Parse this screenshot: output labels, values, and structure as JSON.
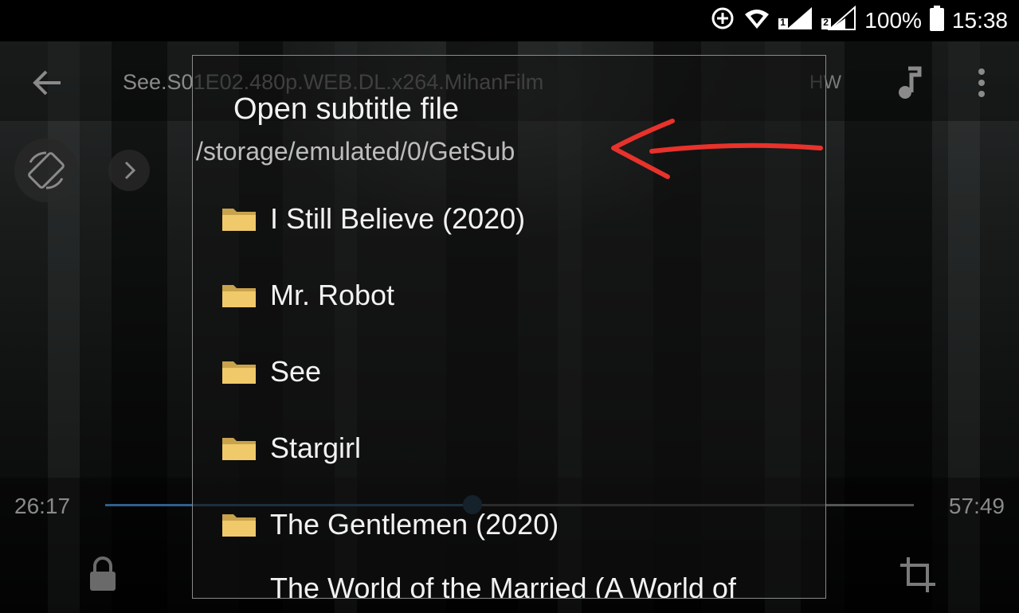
{
  "status_bar": {
    "battery": "100%",
    "time": "15:38",
    "sim1": "1",
    "sim2": "2"
  },
  "player": {
    "video_title": "See.S01E02.480p.WEB.DL.x264.MihanFilm",
    "hw_label": "HW",
    "time_elapsed": "26:17",
    "time_total": "57:49",
    "progress_fraction": 0.454
  },
  "dialog": {
    "title": "Open subtitle file",
    "path": "/storage/emulated/0/GetSub",
    "folders": [
      {
        "label": "I Still Believe (2020)"
      },
      {
        "label": "Mr. Robot"
      },
      {
        "label": "See"
      },
      {
        "label": "Stargirl"
      },
      {
        "label": "The Gentlemen (2020)"
      },
      {
        "label": "The World of the Married (A World of"
      }
    ]
  },
  "colors": {
    "annotation": "#e8322b",
    "folder": "#f0c96a",
    "seek_fill": "#2f5f8a"
  }
}
